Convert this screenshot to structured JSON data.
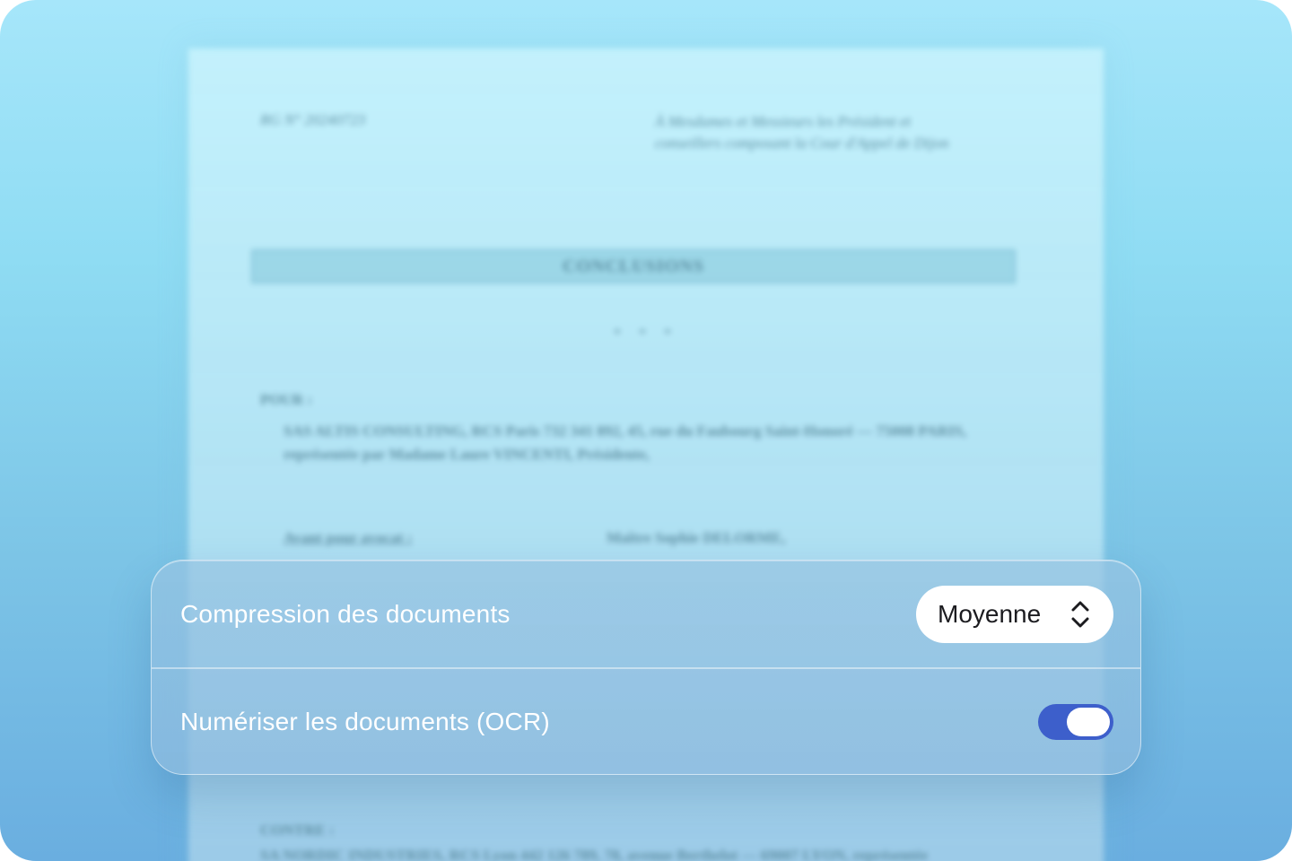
{
  "document": {
    "reference": "RG N° 20240723",
    "addressee": "À Mesdames et Messieurs les Président et conseillers composant la Cour d'Appel de Dijon",
    "title": "CONCLUSIONS",
    "separator": "* * *",
    "pour_label": "POUR :",
    "party_text": "SAS ALTIS CONSULTING, RCS Paris 732 341 892, 45, rue du Faubourg Saint-Honoré — 75008 PARIS, représentée par Madame Laure VINCENTI, Présidente,",
    "counsel_label": "Ayant pour avocat :",
    "counsel_name": "Maître Sophie DELORME,",
    "contre_label": "CONTRE :",
    "party2_text": "SA NORDIC INDUSTRIES, RCS Lyon 442 126 789, 78, avenue Berthelot — 69007 LYON, représentée"
  },
  "settings": {
    "compression": {
      "label": "Compression des documents",
      "value": "Moyenne",
      "icon": "chevron-up-down-icon"
    },
    "ocr": {
      "label": "Numériser les documents (OCR)",
      "enabled": true
    }
  },
  "colors": {
    "toggle_on": "#3d5fcb",
    "panel_text": "#ffffff",
    "select_text": "#1b1b1f"
  }
}
